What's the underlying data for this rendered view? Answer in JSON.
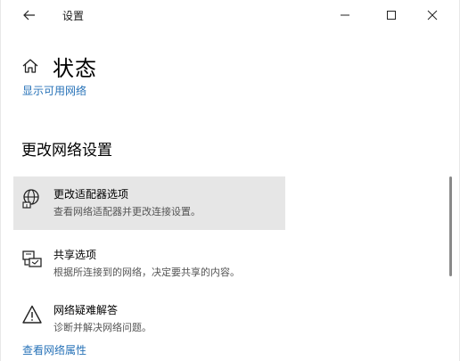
{
  "window": {
    "title": "设置"
  },
  "header": {
    "page_title": "状态"
  },
  "links": {
    "top": "显示可用网络",
    "bottom": "查看网络属性"
  },
  "section": {
    "title": "更改网络设置"
  },
  "items": [
    {
      "title": "更改适配器选项",
      "description": "查看网络适配器并更改连接设置。",
      "icon": "network-adapter-icon"
    },
    {
      "title": "共享选项",
      "description": "根据所连接到的网络，决定要共享的内容。",
      "icon": "sharing-icon"
    },
    {
      "title": "网络疑难解答",
      "description": "诊断并解决网络问题。",
      "icon": "warning-icon"
    }
  ],
  "colors": {
    "link": "#2873b8",
    "hover_background": "#e6e6e6",
    "text": "#000000",
    "secondary_text": "#555555"
  }
}
